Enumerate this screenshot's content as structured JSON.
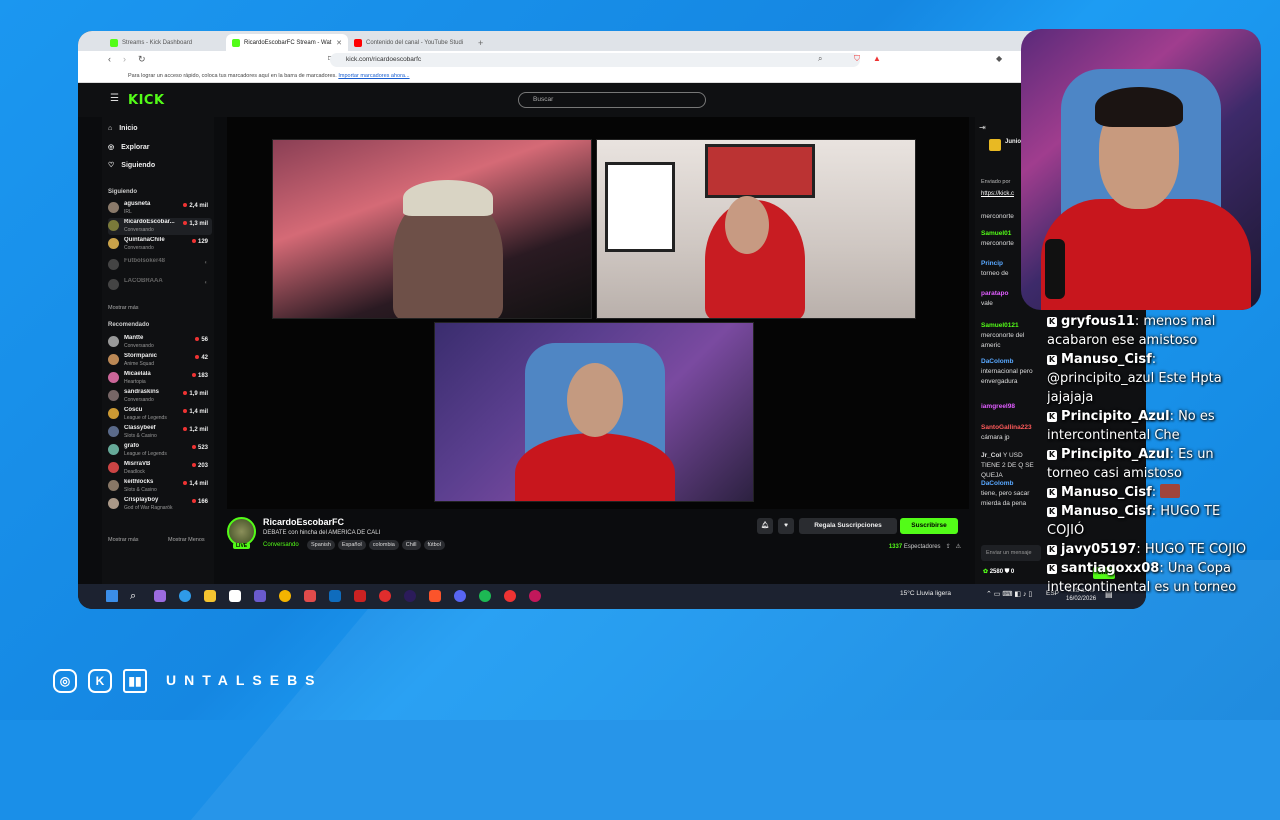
{
  "browser": {
    "tabs": [
      {
        "label": "Streams - Kick Dashboard"
      },
      {
        "label": "RicardoEscobarFC Stream - Wat"
      },
      {
        "label": "Contenido del canal - YouTube Studi"
      }
    ],
    "url": "kick.com/ricardoescobarfc",
    "bookmarks_text": "Para lograr un acceso rápido, coloca tus marcadores aquí en la barra de marcadores.",
    "bookmarks_link": "Importar marcadores ahora..."
  },
  "kick": {
    "logo": "KICK",
    "search_placeholder": "Buscar",
    "nav": [
      {
        "label": "Inicio"
      },
      {
        "label": "Explorar"
      },
      {
        "label": "Siguiendo"
      }
    ],
    "following_header": "Siguiendo",
    "following": [
      {
        "name": "agusneta",
        "sub": "IRL",
        "viewers": "2,4 mil",
        "live": true
      },
      {
        "name": "RicardoEscobar...",
        "sub": "Conversando",
        "viewers": "1,3 mil",
        "live": true
      },
      {
        "name": "QuintanaChile",
        "sub": "Conversando",
        "viewers": "129",
        "live": true
      },
      {
        "name": "Futbolsoker48",
        "sub": "",
        "viewers": "",
        "live": false
      },
      {
        "name": "LACOBRAAA",
        "sub": "",
        "viewers": "",
        "live": false
      }
    ],
    "show_more": "Mostrar más",
    "recommended_header": "Recomendado",
    "recommended": [
      {
        "name": "Mantte",
        "sub": "Conversando",
        "viewers": "56"
      },
      {
        "name": "Stormpanic",
        "sub": "Anime Squad",
        "viewers": "42"
      },
      {
        "name": "Micaelala",
        "sub": "Heartopia",
        "viewers": "183"
      },
      {
        "name": "sandraskins",
        "sub": "Conversando",
        "viewers": "1,9 mil"
      },
      {
        "name": "Coscu",
        "sub": "League of Legends",
        "viewers": "1,4 mil"
      },
      {
        "name": "Classybeef",
        "sub": "Slots & Casino",
        "viewers": "1,2 mil"
      },
      {
        "name": "grafo",
        "sub": "League of Legends",
        "viewers": "523"
      },
      {
        "name": "MisrraVB",
        "sub": "Deadlock",
        "viewers": "203"
      },
      {
        "name": "keithlocks",
        "sub": "Slots & Casino",
        "viewers": "1,4 mil"
      },
      {
        "name": "Crisplayboy",
        "sub": "God of War Ragnarök",
        "viewers": "166"
      }
    ],
    "show_more2": "Mostrar más",
    "show_less": "Mostrar Menos",
    "stream": {
      "channel": "RicardoEscobarFC",
      "title": "DEBATE con hincha del AMERICA DE CALI",
      "category": "Conversando",
      "tags": [
        "Spanish",
        "Español",
        "colombia",
        "Chill",
        "fútbol"
      ],
      "live_badge": "LIVE",
      "gift_label": "Regala Suscripciones",
      "subscribe_label": "Suscribirse",
      "viewers": "1337",
      "viewers_label": "Espectadores"
    },
    "chat": {
      "pinned_user": "Junio",
      "pinned_note": "Enviado por",
      "pinned_link": "https://kick.c",
      "messages": [
        {
          "user": "",
          "text": "merconorte"
        },
        {
          "user": "Samuel01",
          "text": "merconorte"
        },
        {
          "user": "Princip",
          "text": "torneo de"
        },
        {
          "user": "paratapo",
          "text": "vale"
        },
        {
          "user": "Samuel0121",
          "text": "merconorte del americ"
        },
        {
          "user": "DaColomb",
          "text": "internacional pero envergadura"
        },
        {
          "user": "iamgreel98",
          "text": ""
        },
        {
          "user": "SantoGallina223",
          "text": "cámara jp"
        },
        {
          "user": "Jr_Col",
          "text": "Y USD TIENE 2 DE Q SE QUEJA"
        },
        {
          "user": "DaColomb",
          "text": "tiene, pero sacar mierda da pena"
        }
      ],
      "input_placeholder": "Enviar un mensaje",
      "points": "2580",
      "points2": "0",
      "send_label": "Chat"
    }
  },
  "taskbar": {
    "weather": "15°C  Lluvia ligera",
    "lang": "ESP",
    "time": "2:28 a. m.",
    "date": "16/02/2026"
  },
  "overlay_chat": [
    {
      "user": "gryfous11",
      "text": "menos mal acabaron ese amistoso"
    },
    {
      "user": "Manuso_Cisf",
      "text": "@principito_azul Este Hpta jajajaja"
    },
    {
      "user": "Principito_Azul",
      "text": "No es intercontinental Che"
    },
    {
      "user": "Principito_Azul",
      "text": "Es un torneo casi amistoso"
    },
    {
      "user": "Manuso_Cisf",
      "text": ""
    },
    {
      "user": "Manuso_Cisf",
      "text": "HUGO TE COJIÓ"
    },
    {
      "user": "javy05197",
      "text": "HUGO TE COJIO"
    },
    {
      "user": "santiagoxx08",
      "text": "Una Copa intercontinental es un torneo"
    }
  ],
  "branding": {
    "name": "UNTALSEBS",
    "icons": [
      "instagram-icon",
      "kick-icon",
      "twitch-icon"
    ]
  },
  "colors": {
    "kick_green": "#53fc18",
    "background": "#1a8fe8",
    "jersey_red": "#c8161d"
  }
}
